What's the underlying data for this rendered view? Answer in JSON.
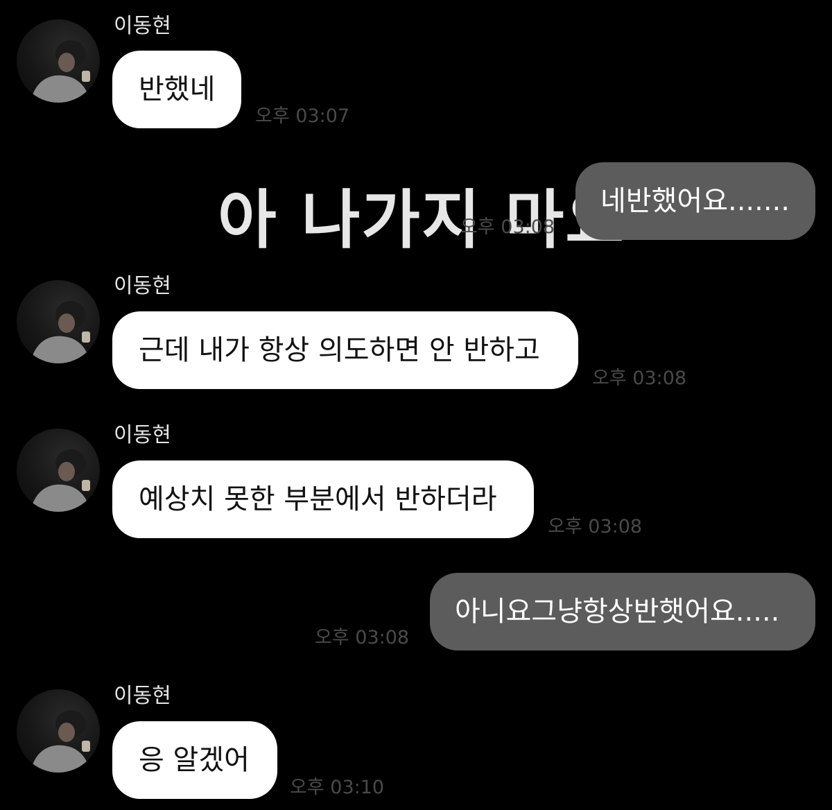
{
  "chat": {
    "messages": [
      {
        "sender": "이동현",
        "text": "반했네",
        "time": "오후 03:07",
        "direction": "incoming"
      },
      {
        "sender": "",
        "text": "네반했어요.......",
        "time": "오후 03:08",
        "direction": "outgoing"
      },
      {
        "sender": "이동현",
        "text": "근데 내가 항상 의도하면 안 반하고",
        "time": "오후 03:08",
        "direction": "incoming"
      },
      {
        "sender": "이동현",
        "text": "예상치 못한 부분에서 반하더라",
        "time": "오후 03:08",
        "direction": "incoming"
      },
      {
        "sender": "",
        "text": "아니요그냥항상반햇어요.....",
        "time": "오후 03:08",
        "direction": "outgoing"
      },
      {
        "sender": "이동현",
        "text": "응 알겠어",
        "time": "오후 03:10",
        "direction": "incoming"
      }
    ]
  },
  "overlay": {
    "caption": "아 나가지 마요"
  },
  "colors": {
    "background": "#000000",
    "incoming_bubble": "#ffffff",
    "outgoing_bubble": "#5c5c5c",
    "timestamp": "#4a4a4a"
  },
  "icons": {
    "avatar": "profile-photo"
  }
}
